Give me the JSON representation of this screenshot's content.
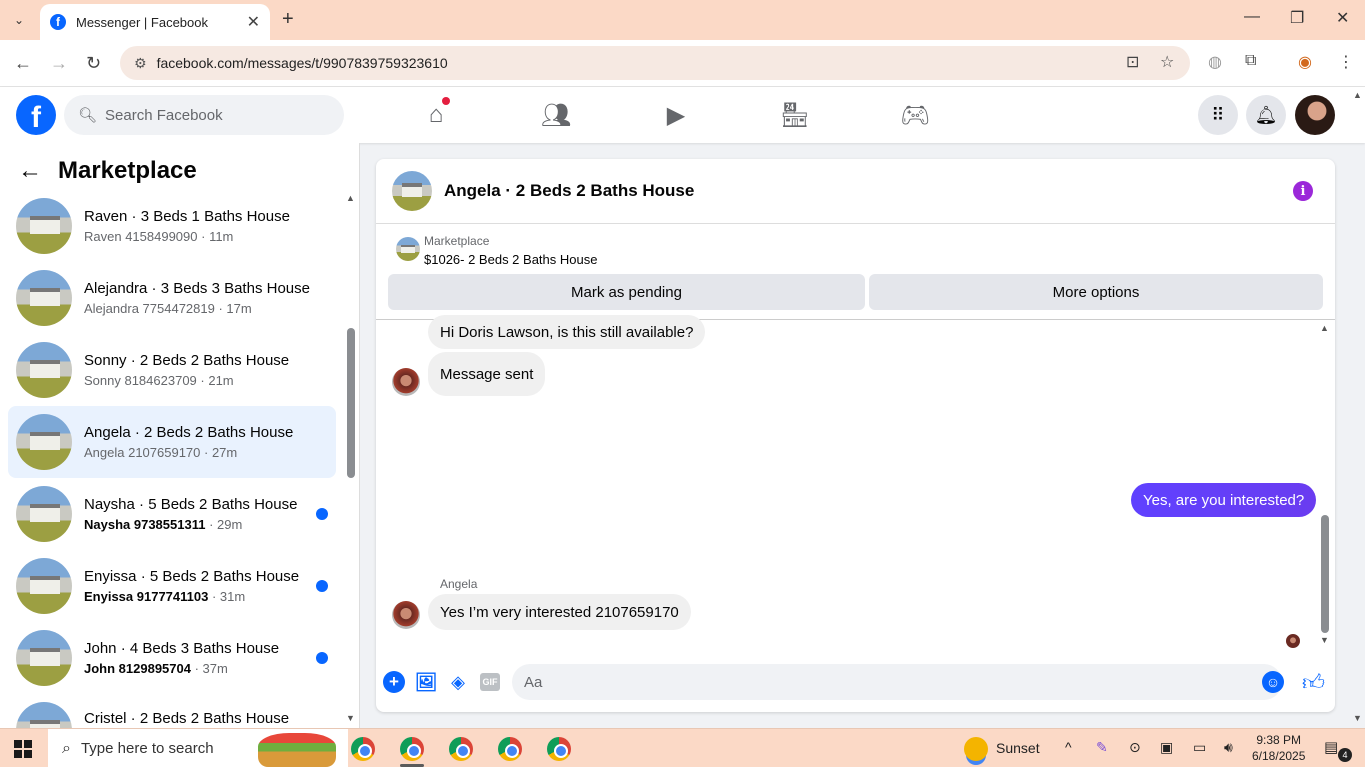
{
  "browser": {
    "tab_title": "Messenger | Facebook",
    "url": "facebook.com/messages/t/9907839759323610"
  },
  "fb": {
    "search_placeholder": "Search Facebook",
    "logo": "f"
  },
  "sidebar": {
    "title": "Marketplace",
    "conversations": [
      {
        "title": "Raven · 3 Beds 1 Baths House",
        "who": "Raven 4158499090",
        "time": "11m",
        "unread": false
      },
      {
        "title": "Alejandra · 3 Beds 3 Baths House",
        "who": "Alejandra 7754472819",
        "time": "17m",
        "unread": false
      },
      {
        "title": "Sonny · 2 Beds 2 Baths House",
        "who": "Sonny 8184623709",
        "time": "21m",
        "unread": false
      },
      {
        "title": "Angela · 2 Beds 2 Baths House",
        "who": "Angela 2107659170",
        "time": "27m",
        "unread": false,
        "active": true
      },
      {
        "title": "Naysha · 5 Beds 2 Baths House",
        "who": "Naysha 9738551311",
        "time": "29m",
        "unread": true
      },
      {
        "title": "Enyissa · 5 Beds 2 Baths House",
        "who": "Enyissa 9177741103",
        "time": "31m",
        "unread": true
      },
      {
        "title": "John · 4 Beds 3 Baths House",
        "who": "John 8129895704",
        "time": "37m",
        "unread": true
      },
      {
        "title": "Cristel · 2 Beds 2 Baths House",
        "who": "",
        "time": "",
        "unread": false
      }
    ]
  },
  "chat": {
    "title": "Angela · 2 Beds 2 Baths House",
    "marketplace_label": "Marketplace",
    "listing": "$1026- 2 Beds 2 Baths House",
    "mark_pending": "Mark as pending",
    "more_options": "More options",
    "messages": {
      "m1": "Hi Doris Lawson, is this still available?",
      "m2": "Message sent",
      "m3": "Yes, are you interested?",
      "sender": "Angela",
      "m4": "Yes I’m very interested 2107659170"
    },
    "composer_placeholder": "Aa",
    "gif": "GIF"
  },
  "taskbar": {
    "search_placeholder": "Type here to search",
    "weather": "Sunset",
    "time": "9:38 PM",
    "date": "6/18/2025",
    "notif_count": "4"
  },
  "colors": {
    "fb_blue": "#0866ff",
    "outgoing_bubble": "#5f41ff",
    "info_purple": "#9b28d9",
    "chrome_tint": "#fbd9c6"
  }
}
